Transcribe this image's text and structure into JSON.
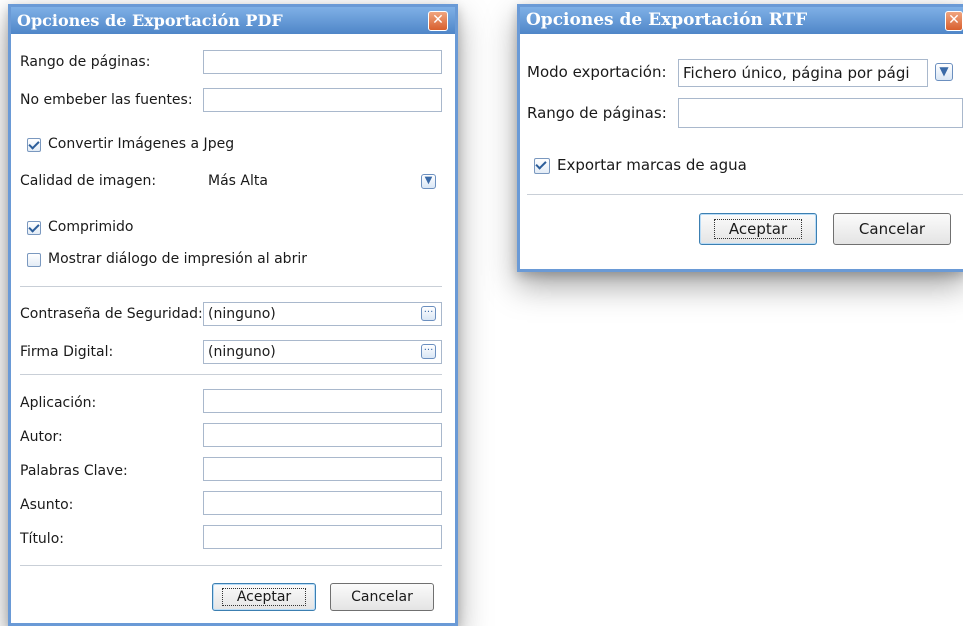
{
  "pdf_dialog": {
    "title": "Opciones de Exportación PDF",
    "close": "✕",
    "page_range_label": "Rango de páginas:",
    "page_range_value": "",
    "no_embed_fonts_label": "No embeber las fuentes:",
    "no_embed_fonts_value": "",
    "convert_jpeg_label": "Convertir Imágenes a Jpeg",
    "convert_jpeg_checked": true,
    "image_quality_label": "Calidad de imagen:",
    "image_quality_value": "Más Alta",
    "compressed_label": "Comprimido",
    "compressed_checked": true,
    "print_dialog_label": "Mostrar diálogo de impresión al abrir",
    "print_dialog_checked": false,
    "security_password_label": "Contraseña de Seguridad:",
    "security_password_value": "(ninguno)",
    "digital_signature_label": "Firma Digital:",
    "digital_signature_value": "(ninguno)",
    "ellipsis": "···",
    "application_label": "Aplicación:",
    "author_label": "Autor:",
    "keywords_label": "Palabras Clave:",
    "subject_label": "Asunto:",
    "title_label": "Título:",
    "accept": "Aceptar",
    "cancel": "Cancelar"
  },
  "rtf_dialog": {
    "title": "Opciones de Exportación RTF",
    "close": "✕",
    "export_mode_label": "Modo exportación:",
    "export_mode_value": "Fichero único, página por pági",
    "page_range_label": "Rango de páginas:",
    "page_range_value": "",
    "watermarks_label": "Exportar marcas de agua",
    "watermarks_checked": true,
    "accept": "Aceptar",
    "cancel": "Cancelar"
  },
  "colors": {
    "titlebar_top": "#7fb0e6",
    "titlebar_bottom": "#4f86c8",
    "close_button": "#d85f2e",
    "field_border": "#a9b8cc"
  },
  "icons": {
    "dropdown": "chevron-down-icon",
    "ellipsis": "ellipsis-icon",
    "close": "close-icon",
    "check": "checkmark-icon"
  }
}
